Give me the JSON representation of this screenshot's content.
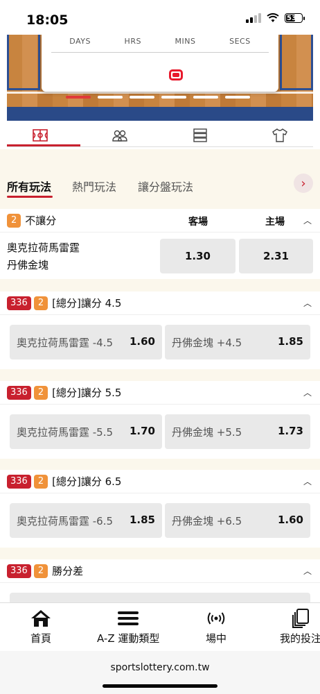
{
  "status": {
    "time": "18:05",
    "battery": "53"
  },
  "countdown": {
    "labels": [
      "DAYS",
      "HRS",
      "MINS",
      "SECS"
    ]
  },
  "icon_tabs": [
    "court-icon",
    "players-icon",
    "stats-icon",
    "jersey-icon"
  ],
  "bet_tabs": [
    "所有玩法",
    "熱門玩法",
    "讓分盤玩法"
  ],
  "moneyline": {
    "badge": "2",
    "title": "不讓分",
    "away_label": "客場",
    "home_label": "主場",
    "team_away": "奧克拉荷馬雷霆",
    "team_home": "丹佛金塊",
    "odd_away": "1.30",
    "odd_home": "2.31"
  },
  "handicaps": [
    {
      "badge_num": "336",
      "badge_sub": "2",
      "title": "[總分]讓分 4.5",
      "left_label": "奧克拉荷馬雷霆 -4.5",
      "left_odd": "1.60",
      "right_label": "丹佛金塊 +4.5",
      "right_odd": "1.85"
    },
    {
      "badge_num": "336",
      "badge_sub": "2",
      "title": "[總分]讓分 5.5",
      "left_label": "奧克拉荷馬雷霆 -5.5",
      "left_odd": "1.70",
      "right_label": "丹佛金塊 +5.5",
      "right_odd": "1.73"
    },
    {
      "badge_num": "336",
      "badge_sub": "2",
      "title": "[總分]讓分 6.5",
      "left_label": "奧克拉荷馬雷霆 -6.5",
      "left_odd": "1.85",
      "right_label": "丹佛金塊 +6.5",
      "right_odd": "1.60"
    }
  ],
  "margin": {
    "badge_num": "336",
    "badge_sub": "2",
    "title": "勝分差"
  },
  "bottom_nav": [
    "首頁",
    "A-Z 運動類型",
    "場中",
    "我的投注"
  ],
  "url": "sportslottery.com.tw",
  "colors": {
    "accent": "#c8202e",
    "badge_orange": "#f0923a"
  }
}
